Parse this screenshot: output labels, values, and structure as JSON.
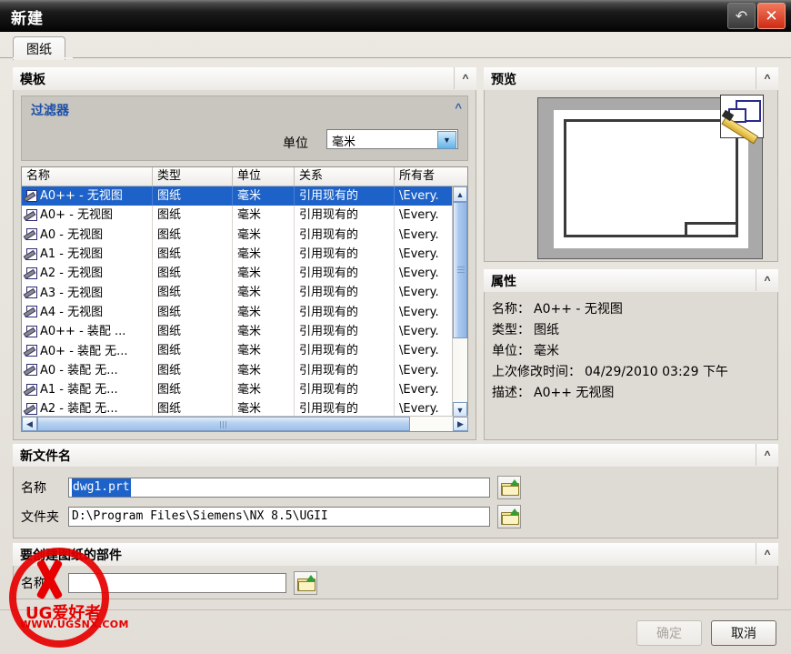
{
  "window": {
    "title": "新建",
    "restore_icon": "restore-icon",
    "close_icon": "close-icon"
  },
  "tabs": [
    {
      "label": "图纸"
    }
  ],
  "template_panel": {
    "header": "模板",
    "collapse_icon": "chevron-up-icon",
    "filter": {
      "title": "过滤器",
      "collapse_icon": "chevron-up-icon",
      "unit_label": "单位",
      "unit_value": "毫米"
    },
    "columns": [
      "名称",
      "类型",
      "单位",
      "关系",
      "所有者"
    ],
    "rows": [
      {
        "name": "A0++ - 无视图",
        "type": "图纸",
        "unit": "毫米",
        "relation": "引用现有的",
        "owner": "\\Every."
      },
      {
        "name": "A0+ - 无视图",
        "type": "图纸",
        "unit": "毫米",
        "relation": "引用现有的",
        "owner": "\\Every."
      },
      {
        "name": "A0 - 无视图",
        "type": "图纸",
        "unit": "毫米",
        "relation": "引用现有的",
        "owner": "\\Every."
      },
      {
        "name": "A1 - 无视图",
        "type": "图纸",
        "unit": "毫米",
        "relation": "引用现有的",
        "owner": "\\Every."
      },
      {
        "name": "A2 - 无视图",
        "type": "图纸",
        "unit": "毫米",
        "relation": "引用现有的",
        "owner": "\\Every."
      },
      {
        "name": "A3 - 无视图",
        "type": "图纸",
        "unit": "毫米",
        "relation": "引用现有的",
        "owner": "\\Every."
      },
      {
        "name": "A4 - 无视图",
        "type": "图纸",
        "unit": "毫米",
        "relation": "引用现有的",
        "owner": "\\Every."
      },
      {
        "name": "A0++ - 装配 ...",
        "type": "图纸",
        "unit": "毫米",
        "relation": "引用现有的",
        "owner": "\\Every."
      },
      {
        "name": "A0+ - 装配 无...",
        "type": "图纸",
        "unit": "毫米",
        "relation": "引用现有的",
        "owner": "\\Every."
      },
      {
        "name": "A0 - 装配 无...",
        "type": "图纸",
        "unit": "毫米",
        "relation": "引用现有的",
        "owner": "\\Every."
      },
      {
        "name": "A1 - 装配 无...",
        "type": "图纸",
        "unit": "毫米",
        "relation": "引用现有的",
        "owner": "\\Every."
      },
      {
        "name": "A2 - 装配 无...",
        "type": "图纸",
        "unit": "毫米",
        "relation": "引用现有的",
        "owner": "\\Every."
      }
    ],
    "selected_row_index": 0
  },
  "preview_panel": {
    "header": "预览",
    "collapse_icon": "chevron-up-icon",
    "image_icon": "drawing-sheet-thumbnail"
  },
  "properties_panel": {
    "header": "属性",
    "collapse_icon": "chevron-up-icon",
    "items": [
      {
        "key": "名称：",
        "value": "A0++ - 无视图"
      },
      {
        "key": "类型：",
        "value": "图纸"
      },
      {
        "key": "单位：",
        "value": "毫米"
      },
      {
        "key": "上次修改时间：",
        "value": "04/29/2010 03:29 下午"
      },
      {
        "key": "描述：",
        "value": "A0++ 无视图"
      }
    ]
  },
  "new_file_panel": {
    "header": "新文件名",
    "collapse_icon": "chevron-up-icon",
    "name_label": "名称",
    "name_value": "dwg1.prt",
    "folder_label": "文件夹",
    "folder_value": "D:\\Program Files\\Siemens\\NX 8.5\\UGII",
    "browse_icon": "folder-open-icon"
  },
  "part_panel": {
    "header": "要创建图纸的部件",
    "collapse_icon": "chevron-up-icon",
    "name_label": "名称",
    "name_value": "",
    "name_placeholder": "",
    "browse_icon": "folder-open-icon"
  },
  "footer": {
    "ok_label": "确定",
    "cancel_label": "取消"
  },
  "watermark": {
    "line1": "UG爱好者",
    "line2": "WWW.UGSNX.COM",
    "color": "#e60000"
  },
  "colors": {
    "selection": "#1d62c9",
    "filter_title": "#1b4fa8",
    "panel_bg": "#dedad4",
    "close_button": "#cf2a14"
  }
}
